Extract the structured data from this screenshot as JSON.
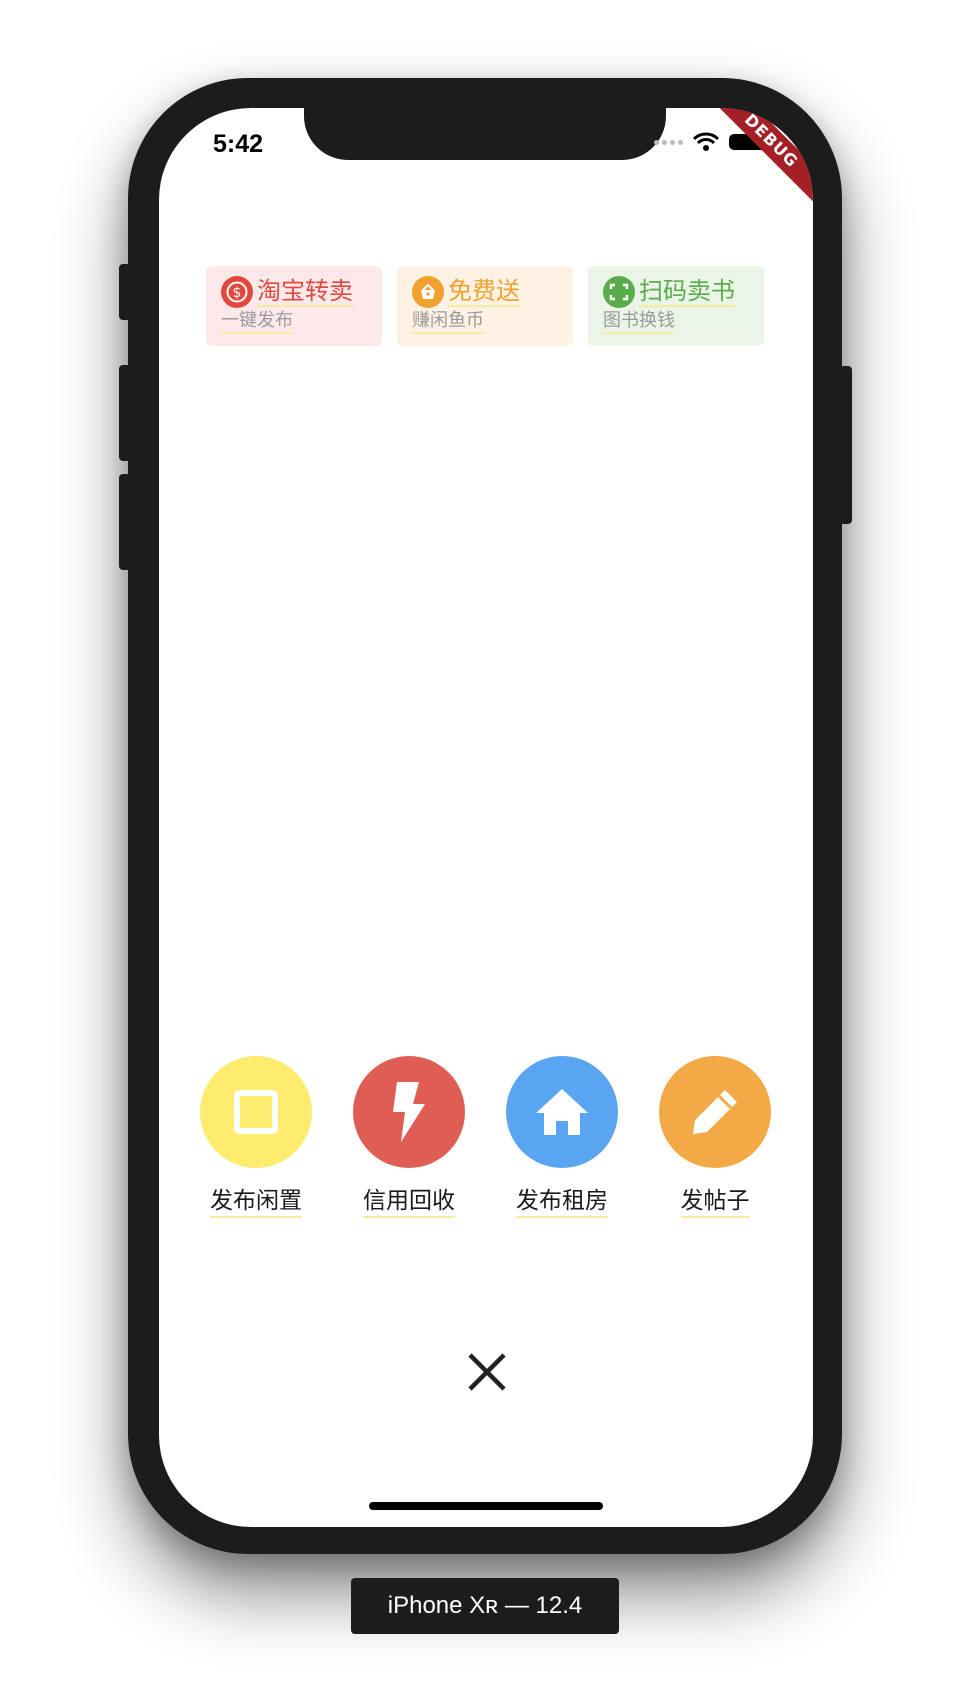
{
  "status_bar": {
    "time": "5:42",
    "debug_label": "DEBUG"
  },
  "quick_actions": [
    {
      "title": "淘宝转卖",
      "subtitle": "一键发布",
      "icon": "dollar-circle-icon",
      "color": "#e2483d",
      "bg": "#fde9ea"
    },
    {
      "title": "免费送",
      "subtitle": "赚闲鱼币",
      "icon": "basket-icon",
      "color": "#f0a12f",
      "bg": "#fdf2e4"
    },
    {
      "title": "扫码卖书",
      "subtitle": "图书换钱",
      "icon": "scan-icon",
      "color": "#5aab4c",
      "bg": "#eaf4e7"
    }
  ],
  "main_actions": [
    {
      "label": "发布闲置",
      "icon": "square-icon",
      "color": "#fdec6f"
    },
    {
      "label": "信用回收",
      "icon": "lightning-icon",
      "color": "#e05d56"
    },
    {
      "label": "发布租房",
      "icon": "house-icon",
      "color": "#5aa5f2"
    },
    {
      "label": "发帖子",
      "icon": "pencil-icon",
      "color": "#f3a946"
    }
  ],
  "close_icon": "close-icon",
  "device_label": "iPhone Xʀ — 12.4"
}
